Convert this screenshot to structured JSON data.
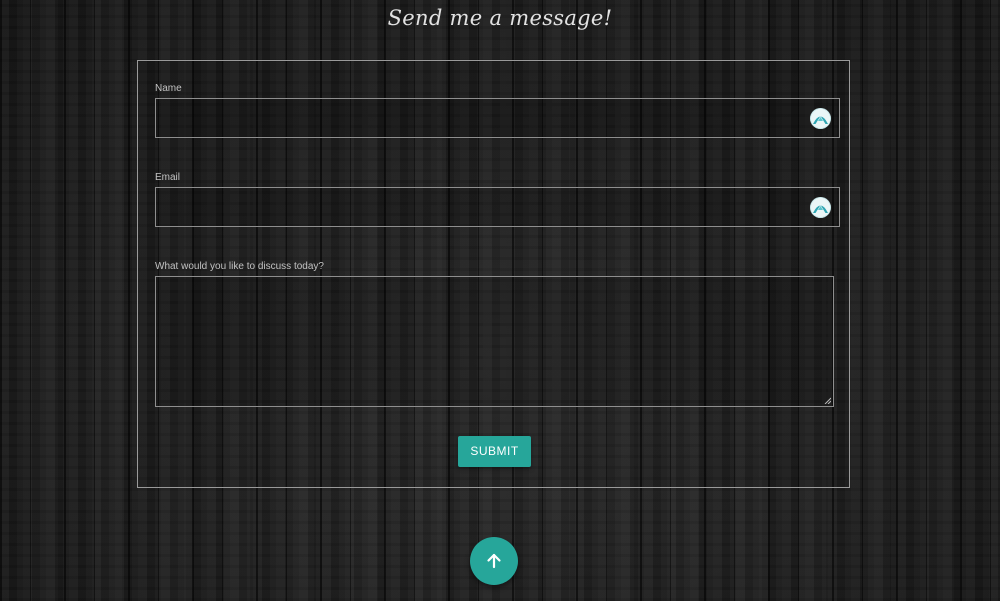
{
  "page": {
    "title": "Send me a message!"
  },
  "form": {
    "name_label": "Name",
    "email_label": "Email",
    "message_label": "What would you like to discuss today?",
    "name_value": "",
    "email_value": "",
    "message_value": "",
    "field_icon": "autofill-mountain-icon",
    "submit_label": "SUBMIT"
  },
  "scroll_top": {
    "icon": "arrow-up-icon"
  },
  "colors": {
    "accent": "#26a69a",
    "background": "#1a1a1a",
    "border": "#8e8e8e",
    "text": "#dddddd"
  }
}
